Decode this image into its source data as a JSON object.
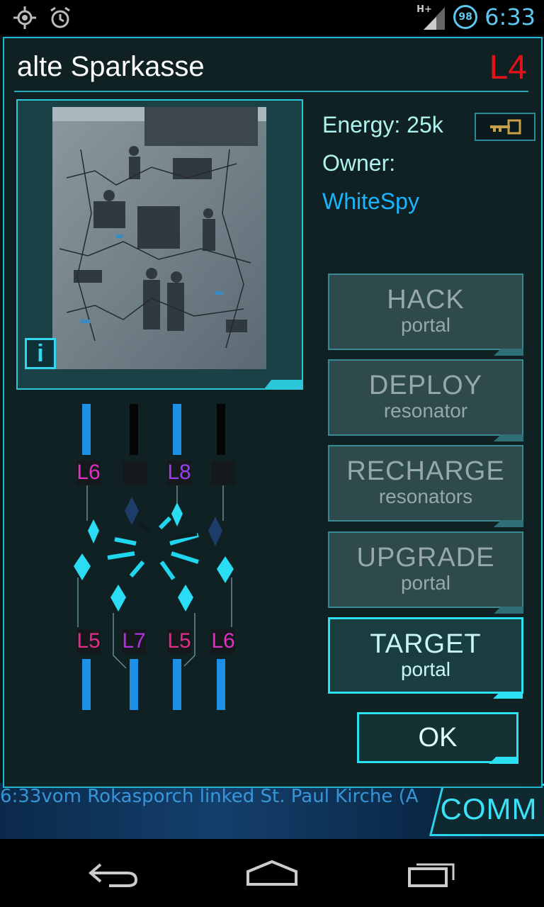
{
  "status_bar": {
    "time": "6:33",
    "battery": "98",
    "network": "H+",
    "icons": [
      "gps-icon",
      "alarm-icon",
      "signal-icon",
      "battery-icon"
    ]
  },
  "portal": {
    "title": "alte Sparkasse",
    "level": "L4",
    "energy_label": "Energy:  25k",
    "owner_label": "Owner:",
    "owner_name": "WhiteSpy",
    "info_label": "i"
  },
  "resonators": {
    "top": [
      {
        "label": "L6",
        "color": "#e02ec8",
        "filled": true
      },
      {
        "label": "",
        "color": "#1b1d1f",
        "filled": false
      },
      {
        "label": "L8",
        "color": "#9a3ef0",
        "filled": true
      },
      {
        "label": "",
        "color": "#1b1d1f",
        "filled": false
      }
    ],
    "bottom": [
      {
        "label": "L5",
        "color": "#e42b8a",
        "filled": true
      },
      {
        "label": "L7",
        "color": "#b231e0",
        "filled": true
      },
      {
        "label": "L5",
        "color": "#e42b8a",
        "filled": true
      },
      {
        "label": "L6",
        "color": "#e02ec8",
        "filled": true
      }
    ]
  },
  "actions": [
    {
      "main": "HACK",
      "sub": "portal",
      "active": false
    },
    {
      "main": "DEPLOY",
      "sub": "resonator",
      "active": false
    },
    {
      "main": "RECHARGE",
      "sub": "resonators",
      "active": false
    },
    {
      "main": "UPGRADE",
      "sub": "portal",
      "active": false
    },
    {
      "main": "TARGET",
      "sub": "portal",
      "active": true
    }
  ],
  "ok_label": "OK",
  "comm": {
    "label": "COMM",
    "ticker": "6:33vom Rokasporch linked St. Paul Kirche (A"
  },
  "colors": {
    "accent": "#2ae0f2",
    "level_red": "#e0131b",
    "owner_blue": "#19b5ff",
    "resonator_bar": "#1e8fe6"
  }
}
